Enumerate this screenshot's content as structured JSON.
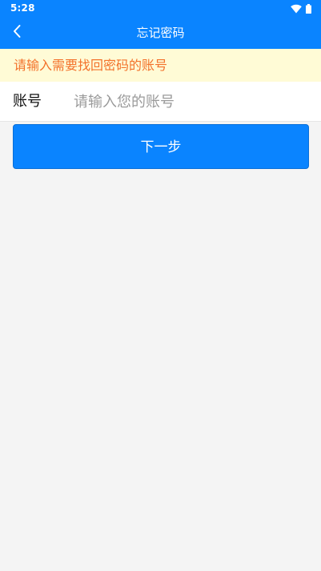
{
  "status_bar": {
    "time": "5:28",
    "icons": [
      "wifi-icon",
      "battery-icon"
    ]
  },
  "header": {
    "back_icon": "chevron-left-icon",
    "title": "忘记密码"
  },
  "hint": {
    "text": "请输入需要找回密码的账号",
    "color": "#f3722b"
  },
  "form": {
    "account_label": "账号",
    "account_value": "",
    "account_placeholder": "请输入您的账号"
  },
  "actions": {
    "next_label": "下一步"
  },
  "colors": {
    "primary": "#0a84ff",
    "hint_background": "#fffbd6",
    "page_background": "#f4f4f4"
  }
}
